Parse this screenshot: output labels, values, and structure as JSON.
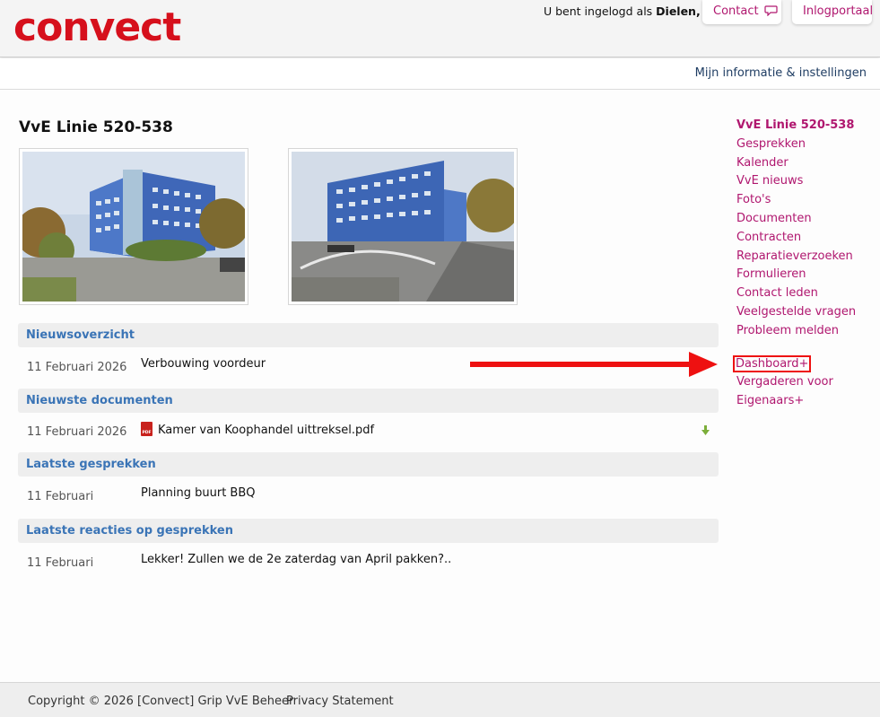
{
  "header": {
    "logo": "convect",
    "login_prefix": "U bent ingelogd als ",
    "login_user": "Dielen, D.",
    "contact_label": "Contact",
    "inlog_label": "Inlogportaal"
  },
  "subbar": {
    "link": "Mijn informatie & instellingen"
  },
  "main": {
    "title": "VvE Linie 520-538",
    "sections": [
      {
        "heading": "Nieuwsoverzicht",
        "date": "11 Februari 2026",
        "text": "Verbouwing voordeur"
      },
      {
        "heading": "Nieuwste documenten",
        "date": "11 Februari 2026",
        "text": "Kamer van Koophandel uittreksel.pdf"
      },
      {
        "heading": "Laatste gesprekken",
        "date": "11 Februari",
        "text": "Planning buurt BBQ"
      },
      {
        "heading": "Laatste reacties op gesprekken",
        "date": "11 Februari",
        "text": "Lekker! Zullen we de 2e zaterdag van April pakken?.."
      }
    ]
  },
  "sidebar": {
    "items": [
      "VvE Linie 520-538",
      "Gesprekken",
      "Kalender",
      "VvE nieuws",
      "Foto's",
      "Documenten",
      "Contracten",
      "Reparatieverzoeken",
      "Formulieren",
      "Contact leden",
      "Veelgestelde vragen",
      "Probleem melden"
    ],
    "extra": [
      "Dashboard+",
      "Vergaderen voor",
      "Eigenaars+"
    ]
  },
  "footer": {
    "copyright": "Copyright © 2026 [Convect] Grip VvE Beheer",
    "privacy": "Privacy Statement"
  },
  "colors": {
    "brand_red": "#d6101c",
    "link_magenta": "#b0176f",
    "section_blue": "#3a74b6",
    "nav_blue": "#1f3d63"
  }
}
